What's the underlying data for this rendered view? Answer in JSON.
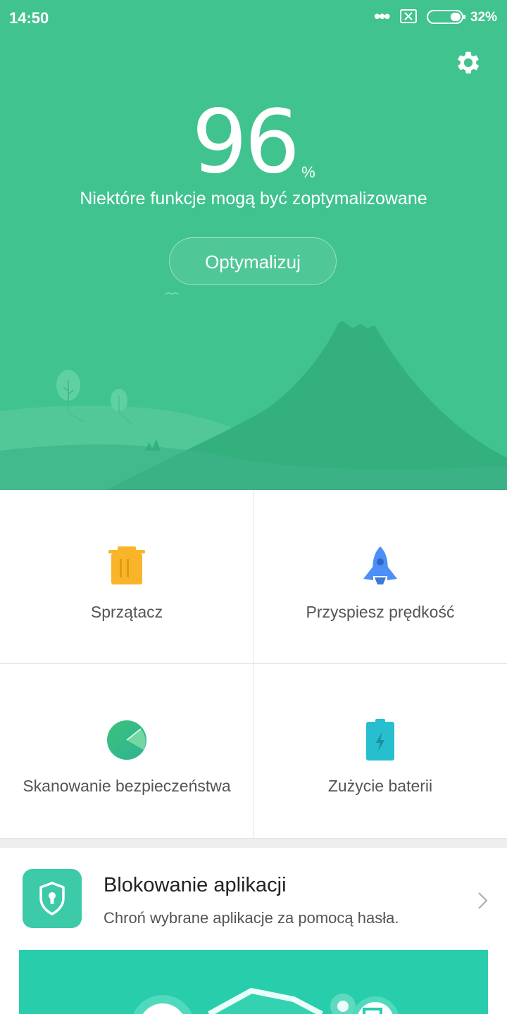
{
  "status_bar": {
    "time": "14:50",
    "dots": "•••",
    "battery_percent": "32%",
    "battery_level": 0.32
  },
  "hero": {
    "score": "96",
    "score_unit": "%",
    "subtitle": "Niektóre funkcje mogą być zoptymalizowane",
    "optimize_label": "Optymalizuj",
    "background_color": "#40c38f"
  },
  "tools": [
    {
      "label": "Sprzątacz",
      "icon": "trash-icon",
      "color": "#f9b52a"
    },
    {
      "label": "Przyspiesz prędkość",
      "icon": "rocket-icon",
      "color": "#4d8ff6"
    },
    {
      "label": "Skanowanie bezpieczeństwa",
      "icon": "security-scan-icon",
      "color": "#3cc481"
    },
    {
      "label": "Zużycie baterii",
      "icon": "battery-icon",
      "color": "#27bfcf"
    }
  ],
  "app_lock": {
    "title": "Blokowanie aplikacji",
    "description": "Chroń wybrane aplikacje za pomocą hasła.",
    "icon": "shield-lock-icon",
    "icon_color": "#3ccaa8"
  },
  "banner": {
    "color": "#28cdab"
  }
}
